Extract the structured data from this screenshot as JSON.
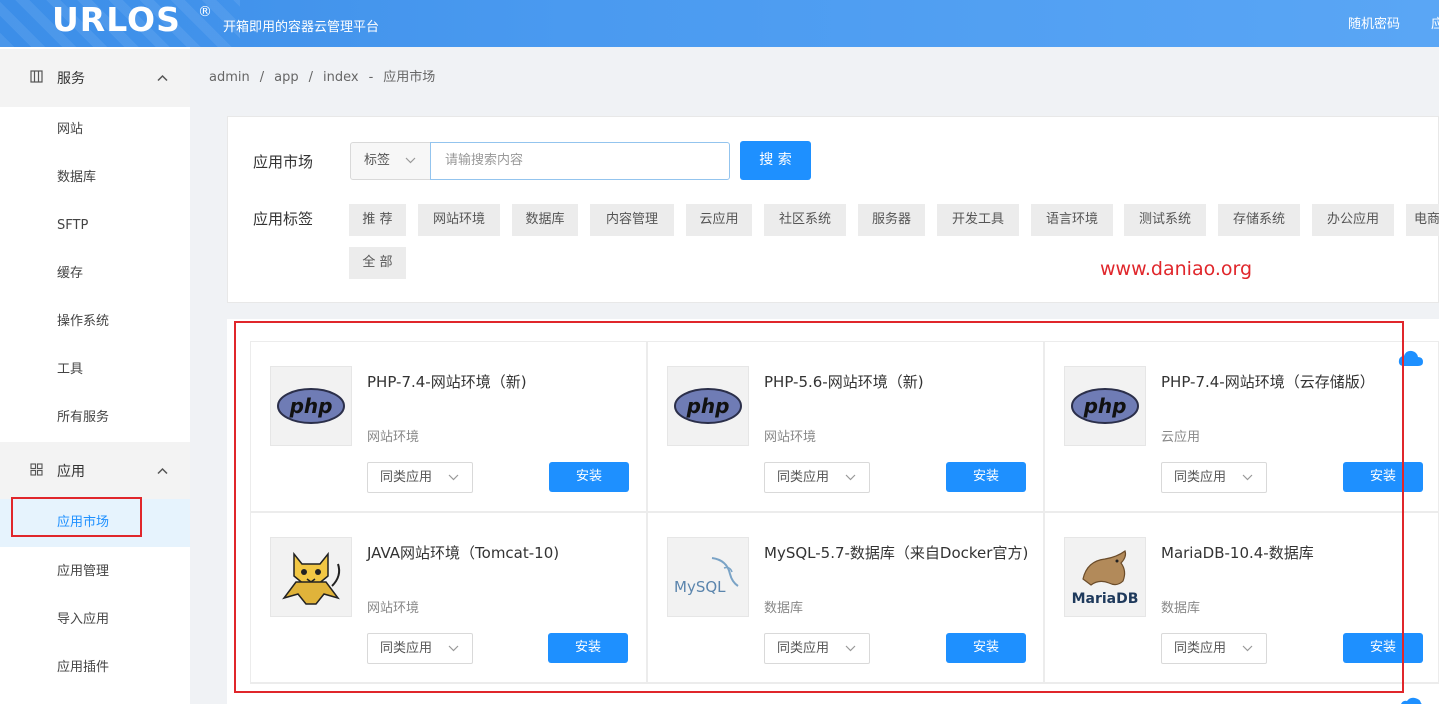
{
  "header": {
    "logo": "URLOS",
    "logo_mark": "®",
    "slogan": "开箱即用的容器云管理平台",
    "nav": [
      "随机密码",
      "应"
    ]
  },
  "sidebar": {
    "groups": [
      {
        "label": "服务",
        "icon": "grid-icon",
        "items": [
          "网站",
          "数据库",
          "SFTP",
          "缓存",
          "操作系统",
          "工具",
          "所有服务"
        ]
      },
      {
        "label": "应用",
        "icon": "apps-icon",
        "items": [
          "应用市场",
          "应用管理",
          "导入应用",
          "应用插件"
        ]
      }
    ],
    "active": "应用市场"
  },
  "breadcrumb": [
    "admin",
    "/",
    "app",
    "/",
    "index",
    "-",
    "应用市场"
  ],
  "search": {
    "market_label": "应用市场",
    "select_value": "标签",
    "placeholder": "请输搜索内容",
    "button": "搜 索",
    "tags_label": "应用标签",
    "tags": [
      "推 荐",
      "网站环境",
      "数据库",
      "内容管理",
      "云应用",
      "社区系统",
      "服务器",
      "开发工具",
      "语言环境",
      "测试系统",
      "存储系统",
      "办公应用",
      "电商",
      "全 部"
    ]
  },
  "watermark": "www.daniao.org",
  "apps": [
    {
      "title": "PHP-7.4-网站环境（新)",
      "category": "网站环境",
      "logo": "php",
      "similar": "同类应用",
      "install": "安装"
    },
    {
      "title": "PHP-5.6-网站环境（新)",
      "category": "网站环境",
      "logo": "php",
      "similar": "同类应用",
      "install": "安装"
    },
    {
      "title": "PHP-7.4-网站环境（云存储版）",
      "category": "云应用",
      "logo": "php",
      "similar": "同类应用",
      "install": "安装"
    },
    {
      "title": "JAVA网站环境（Tomcat-10)",
      "category": "网站环境",
      "logo": "tomcat",
      "similar": "同类应用",
      "install": "安装"
    },
    {
      "title": "MySQL-5.7-数据库（来自Docker官方)",
      "category": "数据库",
      "logo": "mysql",
      "similar": "同类应用",
      "install": "安装"
    },
    {
      "title": "MariaDB-10.4-数据库",
      "category": "数据库",
      "logo": "mariadb",
      "similar": "同类应用",
      "install": "安装"
    }
  ],
  "logo_text": {
    "php": "php",
    "mysql": "MySQL",
    "mariadb": "MariaDB"
  },
  "colors": {
    "primary": "#1e90ff",
    "highlight": "#e0262b",
    "header": "#4a9af0"
  }
}
